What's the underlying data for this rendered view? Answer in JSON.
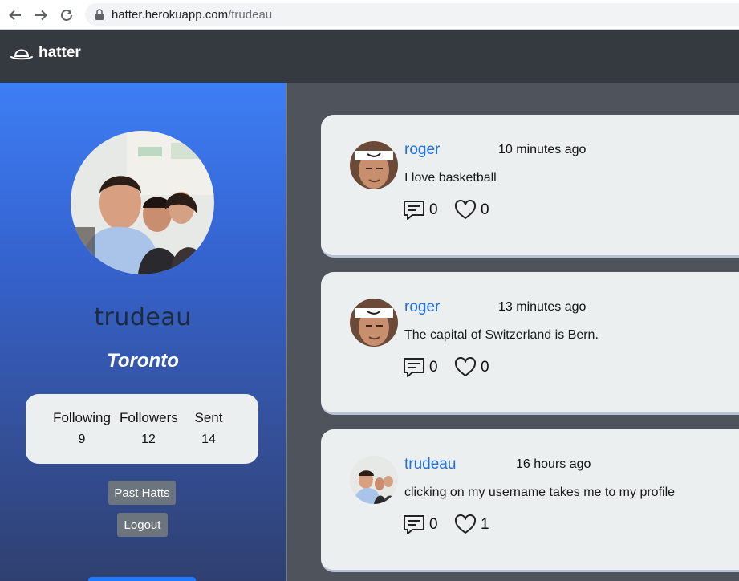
{
  "browser": {
    "url_host": "hatter.herokuapp.com",
    "url_path": "/trudeau"
  },
  "navbar": {
    "brand": "hatter",
    "brand_icon": "bowler-hat-icon"
  },
  "profile": {
    "username": "trudeau",
    "city": "Toronto",
    "stats": [
      {
        "label": "Following",
        "value": "9"
      },
      {
        "label": "Followers",
        "value": "12"
      },
      {
        "label": "Sent",
        "value": "14"
      }
    ],
    "past_hatts_label": "Past Hatts",
    "logout_label": "Logout"
  },
  "feed": [
    {
      "user": "roger",
      "time": "10 minutes ago",
      "text": "I love basketball",
      "comments": "0",
      "likes": "0"
    },
    {
      "user": "roger",
      "time": "13 minutes ago",
      "text": "The capital of Switzerland is Bern.",
      "comments": "0",
      "likes": "0"
    },
    {
      "user": "trudeau",
      "time": "16 hours ago",
      "text": "clicking on my username takes me to my profile",
      "comments": "0",
      "likes": "1"
    }
  ],
  "colors": {
    "navbar": "#343a40",
    "username_link": "#1f6fe0",
    "card": "#eceff0",
    "button_gray": "#6c757d"
  }
}
